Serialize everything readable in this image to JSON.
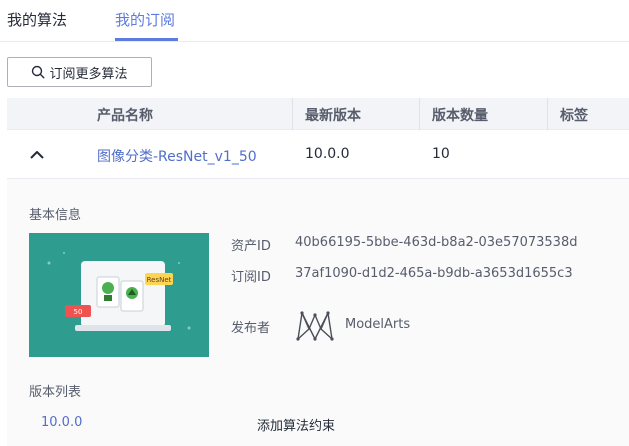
{
  "tabs": [
    {
      "label": "我的算法",
      "active": false
    },
    {
      "label": "我的订阅",
      "active": true
    }
  ],
  "toolbar": {
    "subscribe_more_label": "订阅更多算法",
    "icon": "search-icon"
  },
  "table": {
    "columns": [
      "产品名称",
      "最新版本",
      "版本数量",
      "标签"
    ],
    "rows": [
      {
        "expanded": true,
        "name": "图像分类-ResNet_v1_50",
        "latest_version": "10.0.0",
        "version_count": "10",
        "tags": ""
      }
    ]
  },
  "detail": {
    "basic_info_title": "基本信息",
    "thumbnail": {
      "badge_text": "ResNet",
      "tag_text": "50"
    },
    "asset_id_label": "资产ID",
    "asset_id": "40b66195-5bbe-463d-b8a2-03e57073538d",
    "subscription_id_label": "订阅ID",
    "subscription_id": "37af1090-d1d2-465a-b9db-a3653d1655c3",
    "publisher_label": "发布者",
    "publisher_name": "ModelArts",
    "version_list_title": "版本列表",
    "versions": [
      {
        "version": "10.0.0",
        "action": "添加算法约束"
      }
    ]
  },
  "colors": {
    "accent": "#5e7ce0",
    "link": "#526ecc",
    "thumbnail_bg": "#2e9c8f"
  }
}
